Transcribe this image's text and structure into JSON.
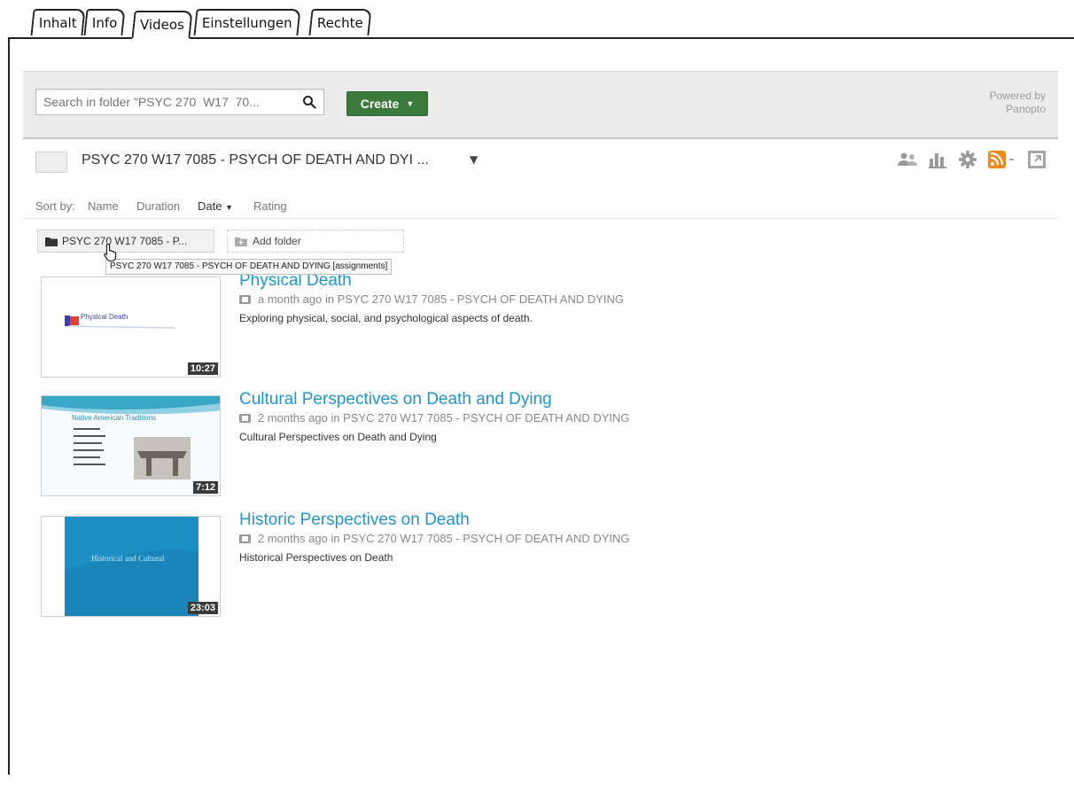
{
  "tabs": [
    {
      "label": "Inhalt",
      "active": false
    },
    {
      "label": "Info",
      "active": false
    },
    {
      "label": "Videos",
      "active": true
    },
    {
      "label": "Einstellungen",
      "active": false
    },
    {
      "label": "Rechte",
      "active": false
    }
  ],
  "toolbar": {
    "search_placeholder": "Search in folder \"PSYC 270  W17  70...",
    "search_icon": "magnifier-icon",
    "create_label": "Create",
    "powered_by_line1": "Powered by",
    "powered_by_line2": "Panopto",
    "create_color": "#3c7a3c"
  },
  "folder": {
    "title": "PSYC 270  W17  7085 - PSYCH OF DEATH AND DYI ...",
    "actions": [
      "users-icon",
      "stats-icon",
      "gear-icon",
      "rss-icon",
      "external-link-icon"
    ]
  },
  "sort": {
    "label": "Sort by:",
    "options": [
      "Name",
      "Duration",
      "Date",
      "Rating"
    ],
    "selected": "Date"
  },
  "subfolder": {
    "label": "PSYC 270 W17 7085 - P...",
    "add_label": "Add folder",
    "tooltip": "PSYC 270  W17  7085 - PSYCH OF DEATH AND DYING [assignments]"
  },
  "sessions": [
    {
      "title": "Physical Death",
      "meta": "a month ago in PSYC 270 W17 7085 - PSYCH OF DEATH AND DYING",
      "description": "Exploring physical, social, and psychological aspects of death.",
      "duration": "10:27",
      "thumb_text": "Physical Death"
    },
    {
      "title": "Cultural Perspectives on Death and Dying",
      "meta": "2 months ago in PSYC 270 W17 7085 - PSYCH OF DEATH AND DYING",
      "description": "Cultural Perspectives on Death and Dying",
      "duration": "7:12",
      "thumb_text": "Native American Traditions"
    },
    {
      "title": "Historic Perspectives on Death",
      "meta": "2 months ago in PSYC 270 W17 7085 - PSYCH OF DEATH AND DYING",
      "description": "Historical Perspectives on Death",
      "duration": "23:03",
      "thumb_text": "Historical and Cultural"
    }
  ],
  "colors": {
    "link_blue": "#1f95d2",
    "rss_orange": "#f28a1b",
    "toolbar_gray": "#ececec"
  }
}
